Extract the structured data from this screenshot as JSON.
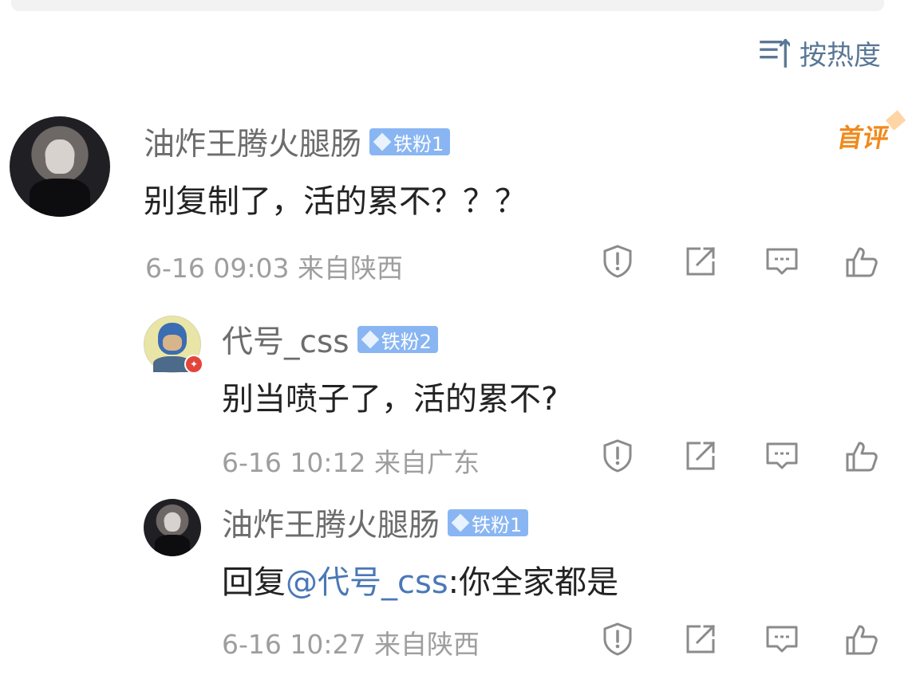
{
  "sort": {
    "label": "按热度",
    "icon": "sort-icon"
  },
  "comments": [
    {
      "name": "油炸王腾火腿肠",
      "badge": "铁粉1",
      "badge_icon": "diamond-icon",
      "text": "别复制了，活的累不？？？",
      "time": "6-16 09:03",
      "location": "来自陕西",
      "flag": "首评"
    },
    {
      "name": "代号_css",
      "badge": "铁粉2",
      "badge_icon": "diamond-icon",
      "text": "别当喷子了，活的累不?",
      "time": "6-16 10:12",
      "location": "来自广东"
    },
    {
      "name": "油炸王腾火腿肠",
      "badge": "铁粉1",
      "badge_icon": "diamond-icon",
      "reply_prefix": "回复",
      "mention": "@代号_css",
      "reply_text": ":你全家都是",
      "time": "6-16 10:27",
      "location": "来自陕西"
    }
  ],
  "actions": {
    "report": "report-icon",
    "share": "share-icon",
    "comment": "comment-icon",
    "like": "like-icon"
  },
  "colors": {
    "accent": "#5a7795",
    "badge": "#89b6f2",
    "meta": "#9e9e9e",
    "name": "#6c6c6c",
    "text": "#222222",
    "mention": "#4a78b7",
    "first_comment": "#f08a1d"
  }
}
